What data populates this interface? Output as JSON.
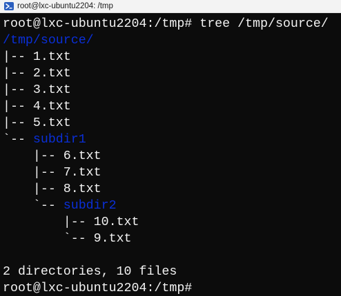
{
  "window": {
    "title": "root@lxc-ubuntu2204: /tmp",
    "icon": "powershell-icon"
  },
  "terminal": {
    "prompt": "root@lxc-ubuntu2204:/tmp# ",
    "command": "tree /tmp/source/",
    "root_dir": "/tmp/source/",
    "entries": [
      {
        "prefix": "|-- ",
        "name": "1.txt"
      },
      {
        "prefix": "|-- ",
        "name": "2.txt"
      },
      {
        "prefix": "|-- ",
        "name": "3.txt"
      },
      {
        "prefix": "|-- ",
        "name": "4.txt"
      },
      {
        "prefix": "|-- ",
        "name": "5.txt"
      },
      {
        "prefix": "`-- ",
        "name": "subdir1"
      },
      {
        "prefix": "    |-- ",
        "name": "6.txt"
      },
      {
        "prefix": "    |-- ",
        "name": "7.txt"
      },
      {
        "prefix": "    |-- ",
        "name": "8.txt"
      },
      {
        "prefix": "    `-- ",
        "name": "subdir2"
      },
      {
        "prefix": "        |-- ",
        "name": "10.txt"
      },
      {
        "prefix": "        `-- ",
        "name": "9.txt"
      }
    ],
    "summary": "2 directories, 10 files",
    "final_prompt": "root@lxc-ubuntu2204:/tmp# ",
    "colors": {
      "background": "#0c0c0c",
      "text": "#f2f2f2",
      "directory": "#0a2fd8"
    }
  }
}
